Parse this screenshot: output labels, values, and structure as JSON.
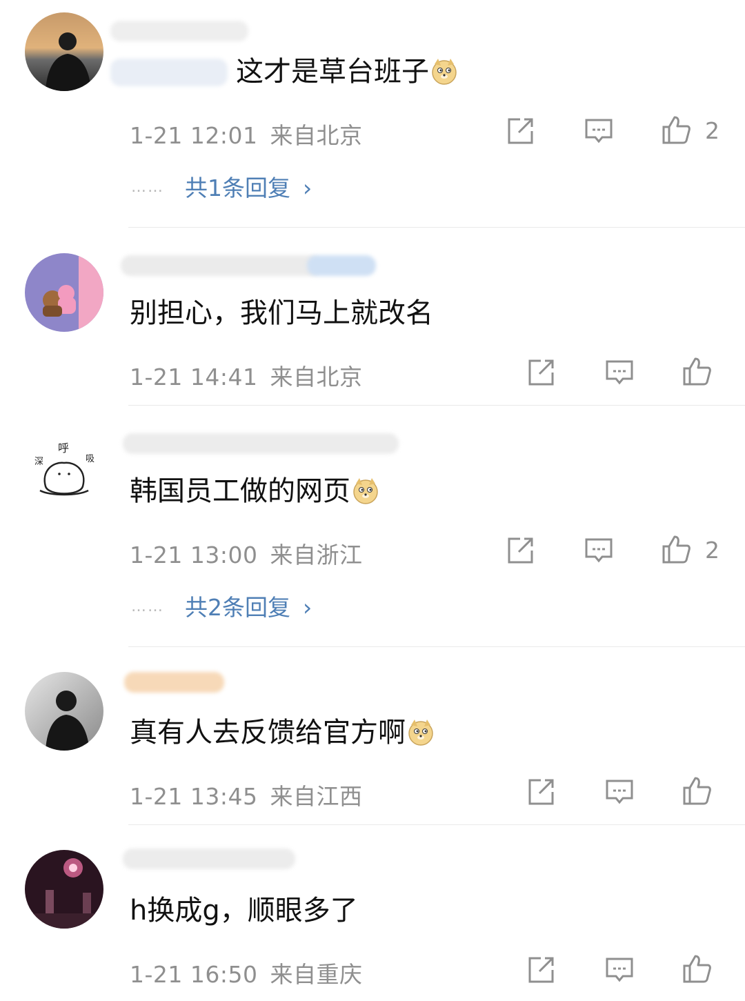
{
  "comments": [
    {
      "text": "这才是草台班子",
      "emoji": "doge-emoji",
      "time": "1-21 12:01",
      "location": "来自北京",
      "likes": "2",
      "replies": "共1条回复"
    },
    {
      "text": "别担心，我们马上就改名",
      "emoji": "",
      "time": "1-21 14:41",
      "location": "来自北京",
      "likes": "",
      "replies": ""
    },
    {
      "text": "韩国员工做的网页",
      "emoji": "doge-emoji",
      "time": "1-21 13:00",
      "location": "来自浙江",
      "likes": "2",
      "replies": "共2条回复"
    },
    {
      "text": "真有人去反馈给官方啊",
      "emoji": "doge-emoji",
      "time": "1-21 13:45",
      "location": "来自江西",
      "likes": "",
      "replies": ""
    },
    {
      "text": "h换成g，顺眼多了",
      "emoji": "",
      "time": "1-21 16:50",
      "location": "来自重庆",
      "likes": "",
      "replies": ""
    }
  ],
  "icons": {
    "share": "share-icon",
    "comment": "comment-icon",
    "like": "thumbs-up-icon",
    "more_replies": "chevron-right-icon"
  },
  "colors": {
    "reply_link": "#4f7fb5",
    "meta_text": "#8f8f8f",
    "divider": "#e9e9e9"
  },
  "ui": {
    "dots": "……",
    "chevron": "›"
  }
}
